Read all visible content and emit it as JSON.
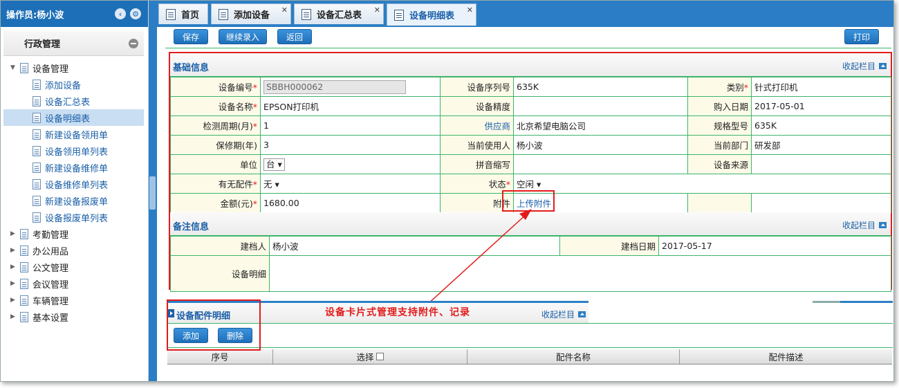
{
  "sidebar": {
    "operator_label": "操作员:杨小波",
    "section_title": "行政管理",
    "tree": [
      {
        "label": "设备管理",
        "level": 1,
        "expanded": true
      },
      {
        "label": "添加设备",
        "level": 2
      },
      {
        "label": "设备汇总表",
        "level": 2
      },
      {
        "label": "设备明细表",
        "level": 2,
        "selected": true
      },
      {
        "label": "新建设备领用单",
        "level": 2
      },
      {
        "label": "设备领用单列表",
        "level": 2
      },
      {
        "label": "新建设备维修单",
        "level": 2
      },
      {
        "label": "设备维修单列表",
        "level": 2
      },
      {
        "label": "新建设备报废单",
        "level": 2
      },
      {
        "label": "设备报废单列表",
        "level": 2
      },
      {
        "label": "考勤管理",
        "level": 1
      },
      {
        "label": "办公用品",
        "level": 1
      },
      {
        "label": "公文管理",
        "level": 1
      },
      {
        "label": "会议管理",
        "level": 1
      },
      {
        "label": "车辆管理",
        "level": 1
      },
      {
        "label": "基本设置",
        "level": 1
      }
    ]
  },
  "tabs": [
    {
      "label": "首页",
      "closable": false
    },
    {
      "label": "添加设备",
      "closable": true
    },
    {
      "label": "设备汇总表",
      "closable": true
    },
    {
      "label": "设备明细表",
      "closable": true,
      "active": true
    }
  ],
  "toolbar": {
    "save": "保存",
    "continue": "继续录入",
    "back": "返回",
    "print": "打印"
  },
  "basic": {
    "title": "基础信息",
    "collapse": "收起栏目",
    "equip_no_label": "设备编号",
    "equip_no_value": "SBBH000062",
    "serial_label": "设备序列号",
    "serial_value": "635K",
    "category_label": "类别",
    "category_value": "针式打印机",
    "name_label": "设备名称",
    "name_value": "EPSON打印机",
    "precision_label": "设备精度",
    "precision_value": "",
    "purchase_label": "购入日期",
    "purchase_value": "2017-05-01",
    "cycle_label": "检测周期(月)",
    "cycle_value": "1",
    "supplier_label": "供应商",
    "supplier_value": "北京希望电脑公司",
    "model_label": "规格型号",
    "model_value": "635K",
    "warranty_label": "保修期(年)",
    "warranty_value": "3",
    "user_label": "当前使用人",
    "user_value": "杨小波",
    "dept_label": "当前部门",
    "dept_value": "研发部",
    "unit_label": "单位",
    "unit_value": "台",
    "pinyin_label": "拼音缩写",
    "pinyin_value": "",
    "source_label": "设备来源",
    "source_value": "",
    "parts_label": "有无配件",
    "parts_value": "无",
    "status_label": "状态",
    "status_value": "空闲",
    "amount_label": "金额(元)",
    "amount_value": "1680.00",
    "attach_label": "附件",
    "attach_link": "上传附件"
  },
  "remark": {
    "title": "备注信息",
    "collapse": "收起栏目",
    "creator_label": "建档人",
    "creator_value": "杨小波",
    "date_label": "建档日期",
    "date_value": "2017-05-17",
    "detail_label": "设备明细"
  },
  "parts_section": {
    "title": "设备配件明细",
    "collapse": "收起栏目",
    "add": "添加",
    "delete": "删除",
    "columns": [
      "序号",
      "选择",
      "配件名称",
      "配件描述"
    ]
  },
  "annotation": "设备卡片式管理支持附件、记录",
  "colors": {
    "primary": "#2b7ec5",
    "highlight": "#e21b1b",
    "grid_line": "#3bb46a",
    "label_bg": "#fdfbe8"
  }
}
